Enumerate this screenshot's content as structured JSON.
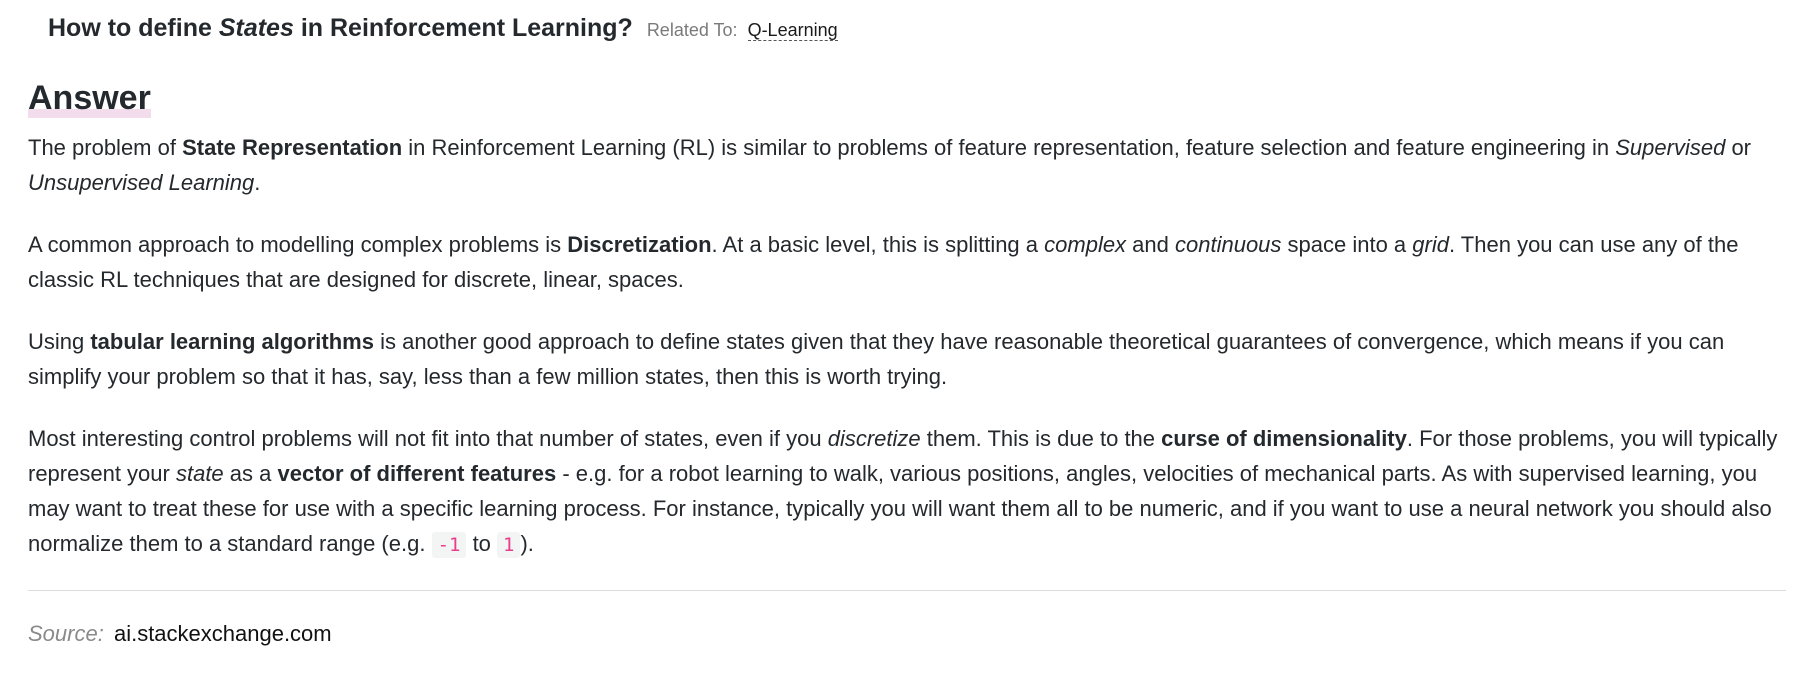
{
  "question": {
    "title_pre": "How to define ",
    "title_em": "States",
    "title_post": " in Reinforcement Learning?",
    "related_label": "Related To:",
    "related_link": "Q-Learning"
  },
  "answer": {
    "heading": "Answer",
    "p1": {
      "t1": "The problem of ",
      "b1": "State Representation",
      "t2": " in Reinforcement Learning (RL) is similar to problems of feature representation, feature selection and feature engineering in ",
      "i1": "Supervised",
      "t3": " or ",
      "i2": "Unsupervised Learning",
      "t4": "."
    },
    "p2": {
      "t1": "A common approach to modelling complex problems is ",
      "b1": "Discretization",
      "t2": ". At a basic level, this is splitting a ",
      "i1": "complex",
      "t3": " and ",
      "i2": "continuous",
      "t4": " space into a ",
      "i3": "grid",
      "t5": ". Then you can use any of the classic RL techniques that are designed for discrete, linear, spaces."
    },
    "p3": {
      "t1": "Using ",
      "b1": "tabular learning algorithms",
      "t2": " is another good approach to define states given that they have reasonable theoretical guarantees of convergence, which means if you can simplify your problem so that it has, say, less than a few million states, then this is worth trying."
    },
    "p4": {
      "t1": "Most interesting control problems will not fit into that number of states, even if you ",
      "i1": "discretize",
      "t2": " them. This is due to the ",
      "b1": "curse of dimensionality",
      "t3": ". For those problems, you will typically represent your ",
      "i2": "state",
      "t4": " as a ",
      "b2": "vector of different features",
      "t5": " - e.g. for a robot learning to walk, various positions, angles, velocities of mechanical parts. As with supervised learning, you may want to treat these for use with a specific learning process. For instance, typically you will want them all to be numeric, and if you want to use a neural network you should also normalize them to a standard range (e.g. ",
      "c1": "-1",
      "t6": " to ",
      "c2": "1",
      "t7": ")."
    }
  },
  "source": {
    "label": "Source:",
    "link": "ai.stackexchange.com"
  }
}
